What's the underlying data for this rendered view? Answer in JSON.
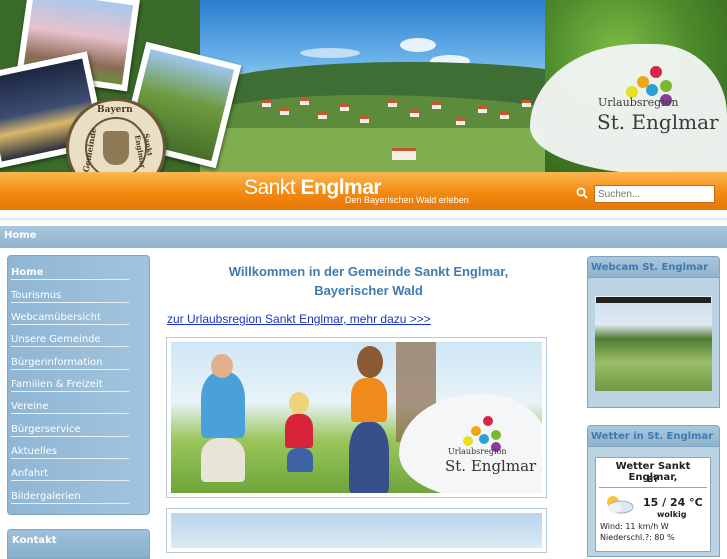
{
  "header": {
    "site_name_light": "Sankt ",
    "site_name_bold": "Englmar",
    "slogan": "Den Bayerischen Wald erleben",
    "search_placeholder": "Suchen...",
    "seal_top": "Bayern",
    "seal_left": "Gemeinde",
    "seal_right": "Sankt Englmar",
    "logo_line1": "Urlaubsregion",
    "logo_line2": "St. Englmar",
    "orange": "#f28a10"
  },
  "nav": {
    "home": "Home"
  },
  "menu": {
    "items": [
      {
        "label": "Home"
      },
      {
        "label": "Tourismus"
      },
      {
        "label": "Webcamübersicht"
      },
      {
        "label": "Unsere Gemeinde"
      },
      {
        "label": "Bürgerinformation"
      },
      {
        "label": "Familien & Freizeit"
      },
      {
        "label": "Vereine"
      },
      {
        "label": "Bürgerservice"
      },
      {
        "label": "Aktuelles"
      },
      {
        "label": "Anfahrt"
      },
      {
        "label": "Bildergalerien"
      }
    ],
    "contact_title": "Kontakt"
  },
  "main": {
    "welcome_line1": "Willkommen in der Gemeinde Sankt Englmar,",
    "welcome_line2": "Bayerischer Wald",
    "region_link": "zur Urlaubsregion Sankt Englmar, mehr dazu >>>",
    "hero_logo_line1": "Urlaubsregion",
    "hero_logo_line2": "St. Englmar"
  },
  "sidebar": {
    "webcam_title": "Webcam St. Englmar",
    "weather_title": "Wetter in St. Englmar",
    "weather": {
      "heading": "Wetter Sankt Englmar,",
      "code": "BY",
      "temp": "15 / 24 °C",
      "condition": "wolkig",
      "wind": "Wind: 11 km/h W",
      "rain": "Niederschl.?: 80 %"
    }
  }
}
